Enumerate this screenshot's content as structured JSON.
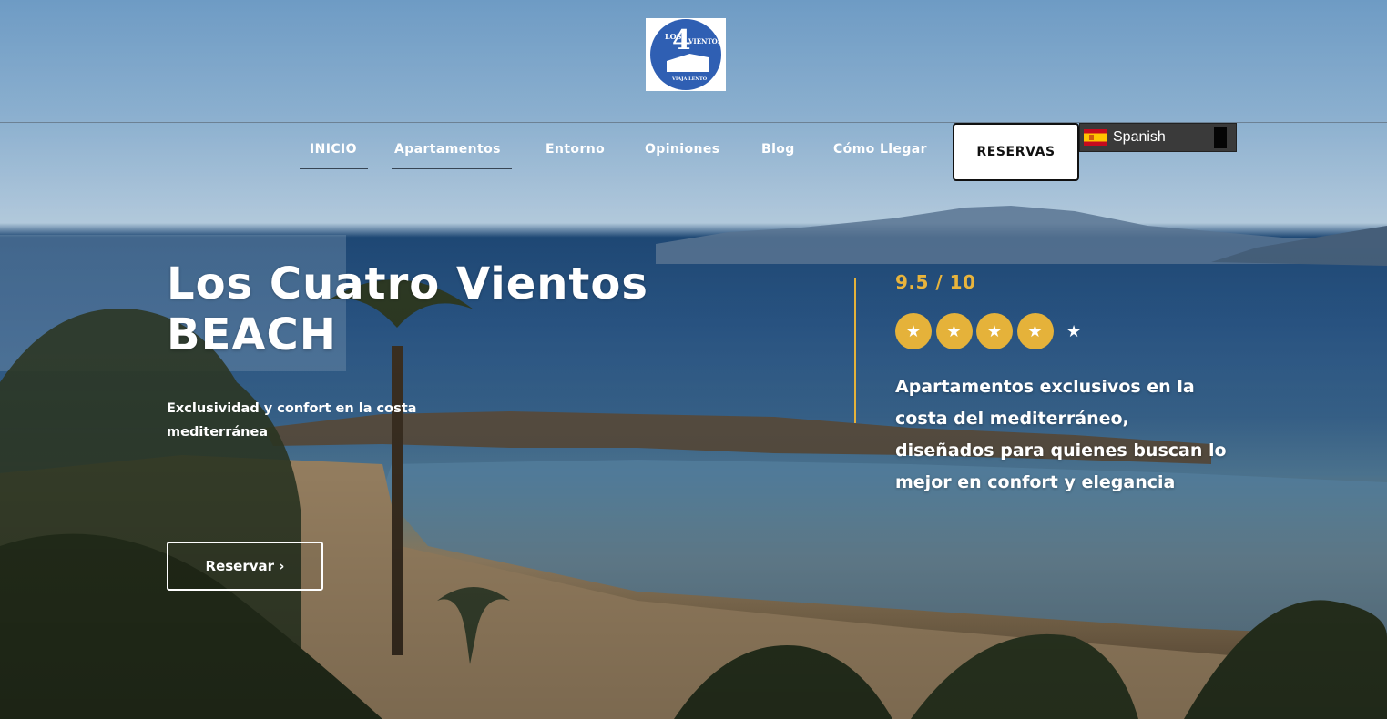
{
  "header": {
    "logo": {
      "text_los": "LOS",
      "text_number": "4",
      "text_vientos": "VIENTOS",
      "text_tagline": "VIAJA LENTO"
    },
    "nav": [
      {
        "label": "INICIO"
      },
      {
        "label": "Apartamentos"
      },
      {
        "label": "Entorno"
      },
      {
        "label": "Opiniones"
      },
      {
        "label": "Blog"
      },
      {
        "label": "Cómo Llegar"
      }
    ],
    "reservas_label": "RESERVAS",
    "language": {
      "selected": "Spanish",
      "flag": "spain-flag-icon"
    }
  },
  "hero": {
    "title": "Los Cuatro Vientos BEACH",
    "subtitle": "Exclusividad y confort en la costa mediterránea",
    "reservar_label": "Reservar ›",
    "rating": {
      "text": "9.5 / 10",
      "value": 9.5,
      "max": 10,
      "stars_filled": 4,
      "stars_total": 5
    },
    "description": "Apartamentos exclusivos en la costa del mediterráneo, diseñados para quienes buscan lo mejor en confort y elegancia"
  },
  "colors": {
    "accent": "#e5b23a",
    "logo_blue": "#2f5fb3",
    "lang_bar": "#3a3a3a"
  }
}
